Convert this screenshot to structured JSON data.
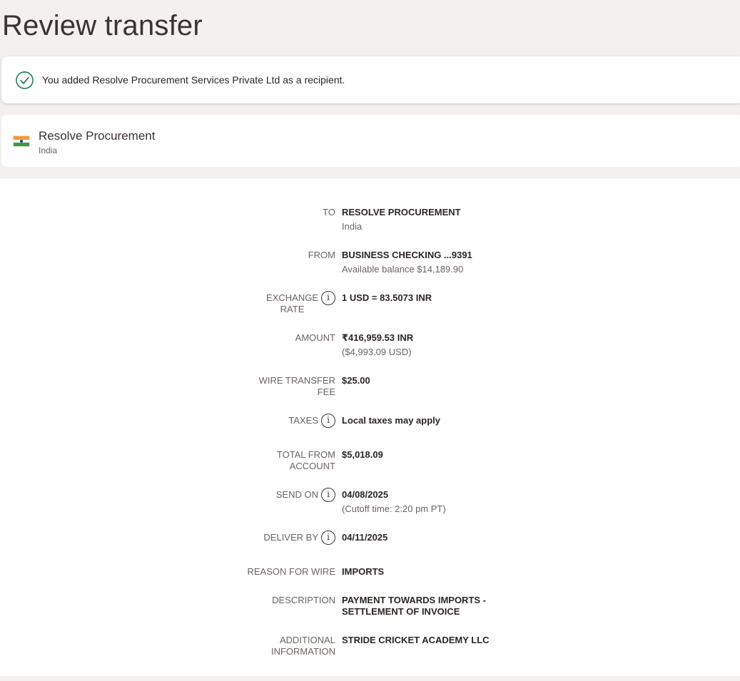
{
  "page": {
    "title": "Review transfer"
  },
  "banner": {
    "message": "You added Resolve Procurement Services Private Ltd as a recipient.",
    "icon": "check-circle-icon",
    "accent": "#1a7a4c"
  },
  "recipient": {
    "name": "Resolve Procurement",
    "country": "India",
    "flag_icon": "india-flag-icon"
  },
  "details": {
    "to": {
      "label": "TO",
      "value": "RESOLVE PROCUREMENT",
      "sub": "India"
    },
    "from": {
      "label": "FROM",
      "value": "BUSINESS CHECKING ...9391",
      "sub": "Available balance $14,189.90"
    },
    "exchange_rate": {
      "label_line1": "EXCHANGE",
      "label_line2": "RATE",
      "value": "1 USD = 83.5073 INR"
    },
    "amount": {
      "label": "AMOUNT",
      "value": "₹416,959.53 INR",
      "sub": "($4,993.09 USD)"
    },
    "wire_fee": {
      "label_line1": "WIRE TRANSFER",
      "label_line2": "FEE",
      "value": "$25.00"
    },
    "taxes": {
      "label": "TAXES",
      "value": "Local taxes may apply"
    },
    "total": {
      "label_line1": "TOTAL FROM",
      "label_line2": "ACCOUNT",
      "value": "$5,018.09"
    },
    "send_on": {
      "label": "SEND ON",
      "value": "04/08/2025",
      "sub": "(Cutoff time: 2:20 pm PT)"
    },
    "deliver_by": {
      "label": "DELIVER BY",
      "value": "04/11/2025"
    },
    "reason": {
      "label": "REASON FOR WIRE",
      "value": "IMPORTS"
    },
    "description": {
      "label": "DESCRIPTION",
      "value_line1": "PAYMENT TOWARDS IMPORTS -",
      "value_line2": "SETTLEMENT OF INVOICE"
    },
    "additional": {
      "label_line1": "ADDITIONAL",
      "label_line2": "INFORMATION",
      "value": "STRIDE CRICKET ACADEMY LLC"
    }
  }
}
